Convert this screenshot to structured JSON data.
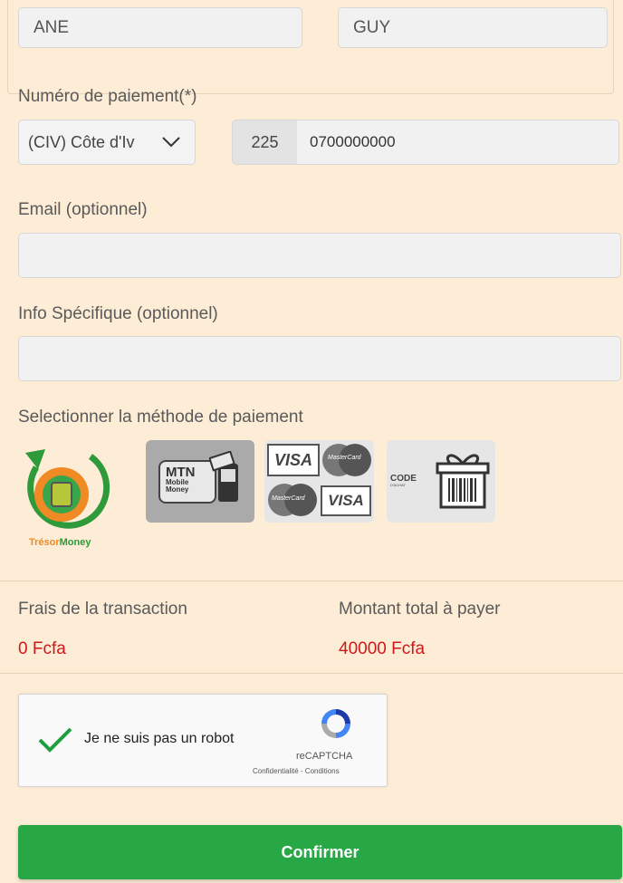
{
  "name_fields": {
    "first_name_value": "ANE",
    "last_name_value": "GUY"
  },
  "payment_number": {
    "label": "Numéro de paiement(*)",
    "country_value": "(CIV) Côte d'Iv",
    "dial_code": "225",
    "phone_value": "0700000000"
  },
  "email": {
    "label": "Email (optionnel)",
    "value": ""
  },
  "info": {
    "label": "Info Spécifique (optionnel)",
    "value": ""
  },
  "payment_method": {
    "label": "Selectionner la méthode de paiement",
    "tresor_logo_text_1": "Trésor",
    "tresor_logo_text_2": "Money",
    "mtn_line1": "MTN",
    "mtn_line2": "Mobile",
    "mtn_line3": "Money",
    "visa_text": "VISA",
    "mastercard_text": "MasterCard",
    "code_text": "CODE",
    "code_sub": "D'ACHAT"
  },
  "totals": {
    "fee_label": "Frais de la transaction",
    "fee_value": "0 Fcfa",
    "total_label": "Montant total à payer",
    "total_value": "40000 Fcfa"
  },
  "captcha": {
    "label": "Je ne suis pas un robot",
    "brand": "reCAPTCHA",
    "links": "Confidentialité - Conditions"
  },
  "confirm_label": "Confirmer",
  "colors": {
    "confirm_green": "#28a745",
    "amount_red": "#d0181a",
    "background": "#fdecd6"
  }
}
